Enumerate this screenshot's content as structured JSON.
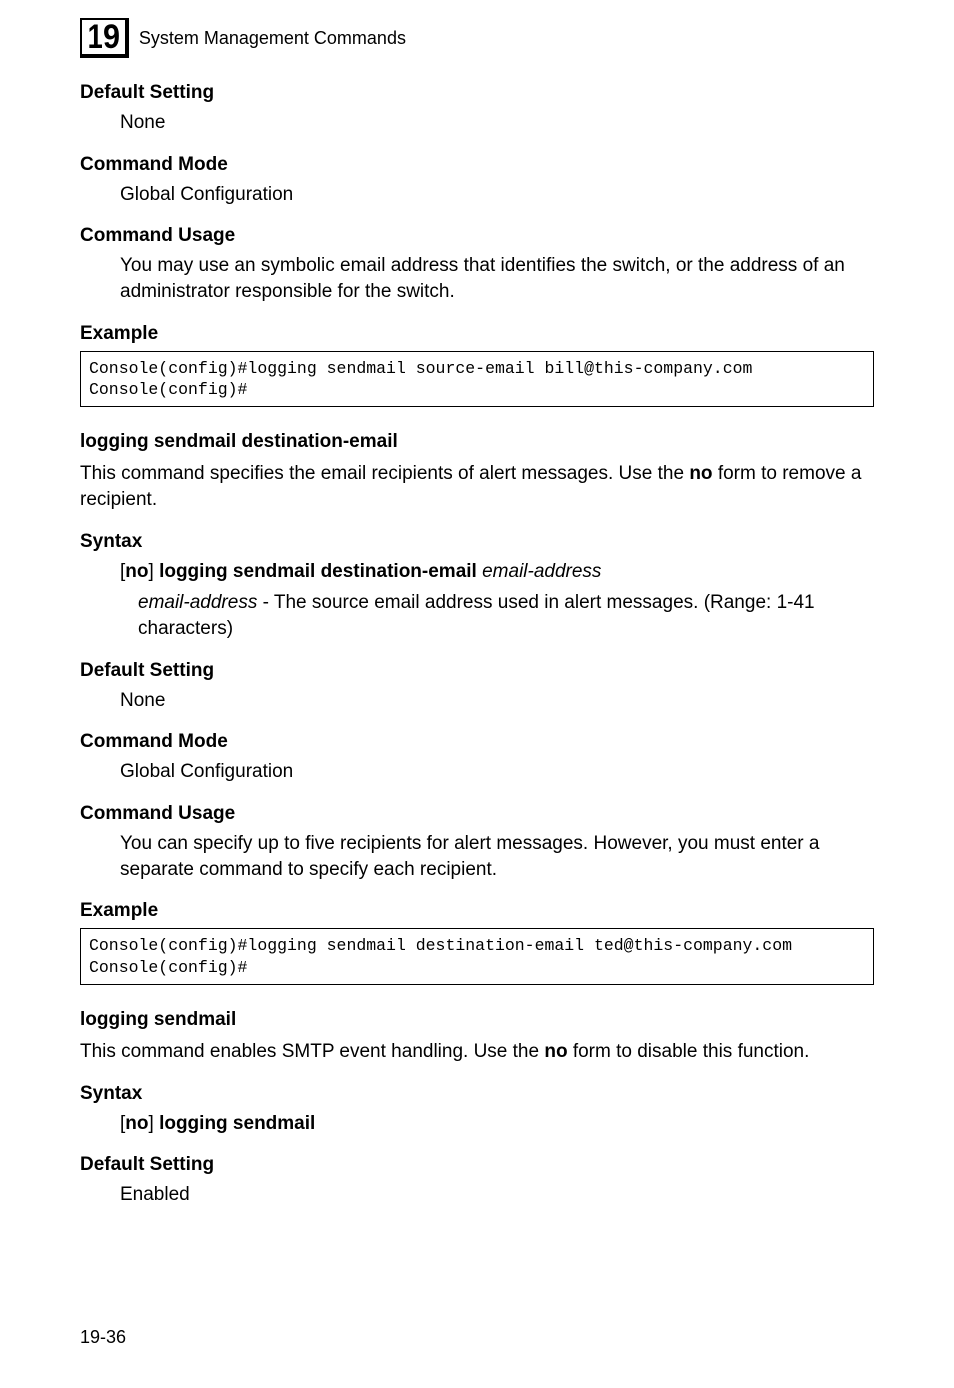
{
  "chapter": {
    "number_d1": "1",
    "number_d2": "9",
    "title": "System Management Commands"
  },
  "s1": {
    "defset_h": "Default Setting",
    "defset_v": "None",
    "cmdmode_h": "Command Mode",
    "cmdmode_v": "Global Configuration",
    "cmdusage_h": "Command Usage",
    "cmdusage_v": "You may use an symbolic email address that identifies the switch, or the address of an administrator responsible for the switch.",
    "example_h": "Example",
    "example_code": "Console(config)#logging sendmail source-email bill@this-company.com\nConsole(config)#"
  },
  "s2": {
    "title": "logging sendmail destination-email",
    "desc_pre": "This command specifies the email recipients of alert messages. Use the ",
    "desc_bold": "no",
    "desc_post": " form to remove a recipient.",
    "syntax_h": "Syntax",
    "syntax_open": "[",
    "syntax_no": "no",
    "syntax_close": "] ",
    "syntax_cmd": "logging sendmail destination-email",
    "syntax_param": " email-address",
    "param_name": "email-address",
    "param_desc": " - The source email address used in alert messages. (Range: 1-41 characters)",
    "defset_h": "Default Setting",
    "defset_v": "None",
    "cmdmode_h": "Command Mode",
    "cmdmode_v": "Global Configuration",
    "cmdusage_h": "Command Usage",
    "cmdusage_v": "You can specify up to five recipients for alert messages. However, you must enter a separate command to specify each recipient.",
    "example_h": "Example",
    "example_code": "Console(config)#logging sendmail destination-email ted@this-company.com\nConsole(config)#"
  },
  "s3": {
    "title": "logging sendmail",
    "desc_pre": "This command enables SMTP event handling. Use the ",
    "desc_bold": "no",
    "desc_post": " form to disable this function.",
    "syntax_h": "Syntax",
    "syntax_open": "[",
    "syntax_no": "no",
    "syntax_close": "] ",
    "syntax_cmd": "logging sendmail",
    "defset_h": "Default Setting",
    "defset_v": "Enabled"
  },
  "page_number": "19-36"
}
